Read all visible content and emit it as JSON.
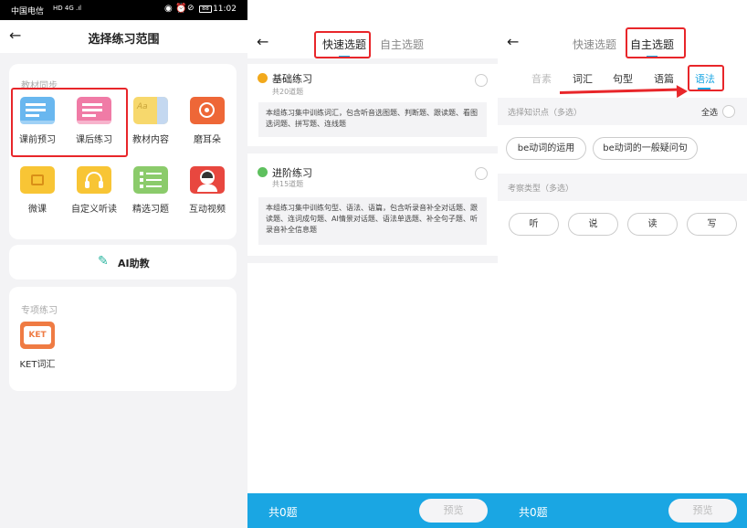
{
  "statusbar": {
    "carrier": "中国电信",
    "signal": "HD 4G .ıl",
    "time": "11:02",
    "battery": "88"
  },
  "panel1": {
    "title": "选择练习范围",
    "sync_section": "教材同步",
    "grid": [
      {
        "label": "课前预习",
        "icon": "book-blue-icon"
      },
      {
        "label": "课后练习",
        "icon": "book-pink-icon"
      },
      {
        "label": "教材内容",
        "icon": "textbook-icon"
      },
      {
        "label": "磨耳朵",
        "icon": "record-player-icon"
      },
      {
        "label": "微课",
        "icon": "folder-book-icon"
      },
      {
        "label": "自定义听读",
        "icon": "headphones-icon"
      },
      {
        "label": "精选习题",
        "icon": "checklist-icon"
      },
      {
        "label": "互动视频",
        "icon": "video-avatar-icon"
      }
    ],
    "ai_button": "AI助教",
    "special_section": "专项练习",
    "special_items": [
      {
        "label": "KET词汇",
        "icon_text": "KET"
      }
    ]
  },
  "panel2": {
    "tabs": [
      "快速选题",
      "自主选题"
    ],
    "exercises": [
      {
        "title": "基础练习",
        "count": "共20道题",
        "desc": "本组练习集中训练词汇，包含听音选图题、判断题、跟读题、看图选词题、拼写题、连线题"
      },
      {
        "title": "进阶练习",
        "count": "共15道题",
        "desc": "本组练习集中训练句型、语法、语篇，包含听录音补全对话题、跟读题、连词成句题、AI情景对话题、语法单选题、补全句子题、听录音补全信息题"
      }
    ],
    "total": "共0题",
    "preview": "预览"
  },
  "panel3": {
    "tabs": [
      "快速选题",
      "自主选题"
    ],
    "subtabs": [
      "音素",
      "词汇",
      "句型",
      "语篇",
      "语法"
    ],
    "knowledge_label": "选择知识点（多选）",
    "select_all": "全选",
    "knowledge_chips": [
      "be动词的运用",
      "be动词的一般疑问句"
    ],
    "type_label": "考察类型（多选）",
    "type_chips": [
      "听",
      "说",
      "读",
      "写"
    ],
    "total": "共0题",
    "preview": "预览"
  },
  "colors": {
    "accent": "#1aa6e3",
    "highlight": "#e8262a"
  }
}
